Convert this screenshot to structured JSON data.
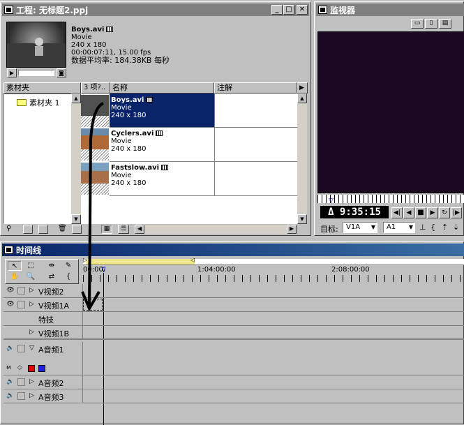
{
  "project": {
    "title": "工程: 无标题2.ppj",
    "preview": {
      "name": "Boys.avi",
      "type": "Movie",
      "size": "240 x 180",
      "duration": "00:00:07:11, 15.00 fps",
      "datarate": "数据平均率: 184.38KB 每秒"
    },
    "bins_header": "素材夹",
    "bin_item": "素材夹 1",
    "count_header": "3 项?..",
    "name_header": "名称",
    "notes_header": "注解",
    "clips": [
      {
        "name": "Boys.avi",
        "type": "Movie",
        "size": "240 x 180"
      },
      {
        "name": "Cyclers.avi",
        "type": "Movie",
        "size": "240 x 180"
      },
      {
        "name": "Fastslow.avi",
        "type": "Movie",
        "size": "240 x 180"
      }
    ]
  },
  "monitor": {
    "title": "监视器",
    "timecode": "Δ 9:35:15",
    "target_label": "目标:",
    "video_target": "V1A",
    "audio_target": "A1"
  },
  "timeline": {
    "title": "时间线",
    "ruler": [
      "00:00",
      "1:04:00:00",
      "2:08:00:00"
    ],
    "tracks": {
      "v2": "V视频2",
      "v1a": "V视频1A",
      "fx": "特技",
      "v1b": "V视频1B",
      "a1": "A音频1",
      "a2": "A音频2",
      "a3": "A音频3"
    }
  },
  "colors": {
    "title_active": "#0a246a",
    "selection": "#0a246a",
    "monitor_bg": "#1c0820",
    "work_area": "#f0e68c"
  }
}
